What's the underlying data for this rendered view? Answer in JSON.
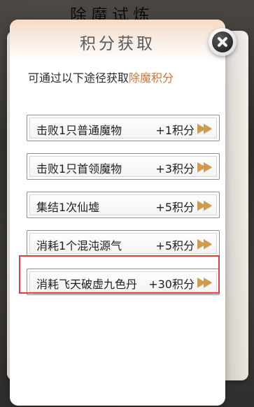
{
  "background": {
    "title": "除魔试炼"
  },
  "dialog": {
    "title": "积分获取",
    "intro_prefix": "可通过以下途径获取",
    "intro_highlight": "除魔积分"
  },
  "rewards": [
    {
      "label": "击败1只普通魔物",
      "value": "+1积分"
    },
    {
      "label": "击败1只首领魔物",
      "value": "+3积分"
    },
    {
      "label": "集结1次仙墟",
      "value": "+5积分"
    },
    {
      "label": "消耗1个混沌源气",
      "value": "+5积分"
    },
    {
      "label": "消耗飞天破虚九色丹",
      "value": "+30积分"
    }
  ],
  "icons": {
    "close": "close-icon",
    "arrow": "double-arrow-icon"
  },
  "colors": {
    "highlight_text": "#c57a41",
    "highlight_box": "#e0403a",
    "arrow": "#d09a4b"
  }
}
